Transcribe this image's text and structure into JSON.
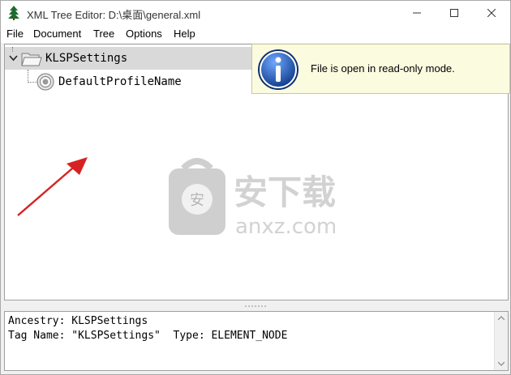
{
  "window": {
    "title": "XML Tree Editor: D:\\桌面\\general.xml",
    "buttons": {
      "minimize": "minimize",
      "maximize": "maximize",
      "close": "close"
    }
  },
  "menu": {
    "items": [
      {
        "label": "File"
      },
      {
        "label": "Document"
      },
      {
        "label": "Tree"
      },
      {
        "label": "Options"
      },
      {
        "label": "Help"
      }
    ]
  },
  "tree": {
    "root": {
      "label": "KLSPSettings",
      "icon": "folder-icon",
      "expanded": true
    },
    "children": [
      {
        "label": "DefaultProfileName",
        "icon": "attribute-node-icon"
      }
    ]
  },
  "notice": {
    "icon": "info-icon",
    "message": "File is open in read-only mode."
  },
  "watermark": {
    "text": "安下载",
    "subtext": "anxz.com"
  },
  "details": {
    "ancestry_label": "Ancestry:",
    "ancestry_value": "KLSPSettings",
    "tag_label": "Tag Name:",
    "tag_value": "\"KLSPSettings\"",
    "type_label": "Type:",
    "type_value": "ELEMENT_NODE"
  },
  "colors": {
    "selection": "#d9d9d9",
    "notice_bg": "#fbfbe0",
    "info_blue": "#1a4fa0",
    "arrow": "#d62222"
  }
}
